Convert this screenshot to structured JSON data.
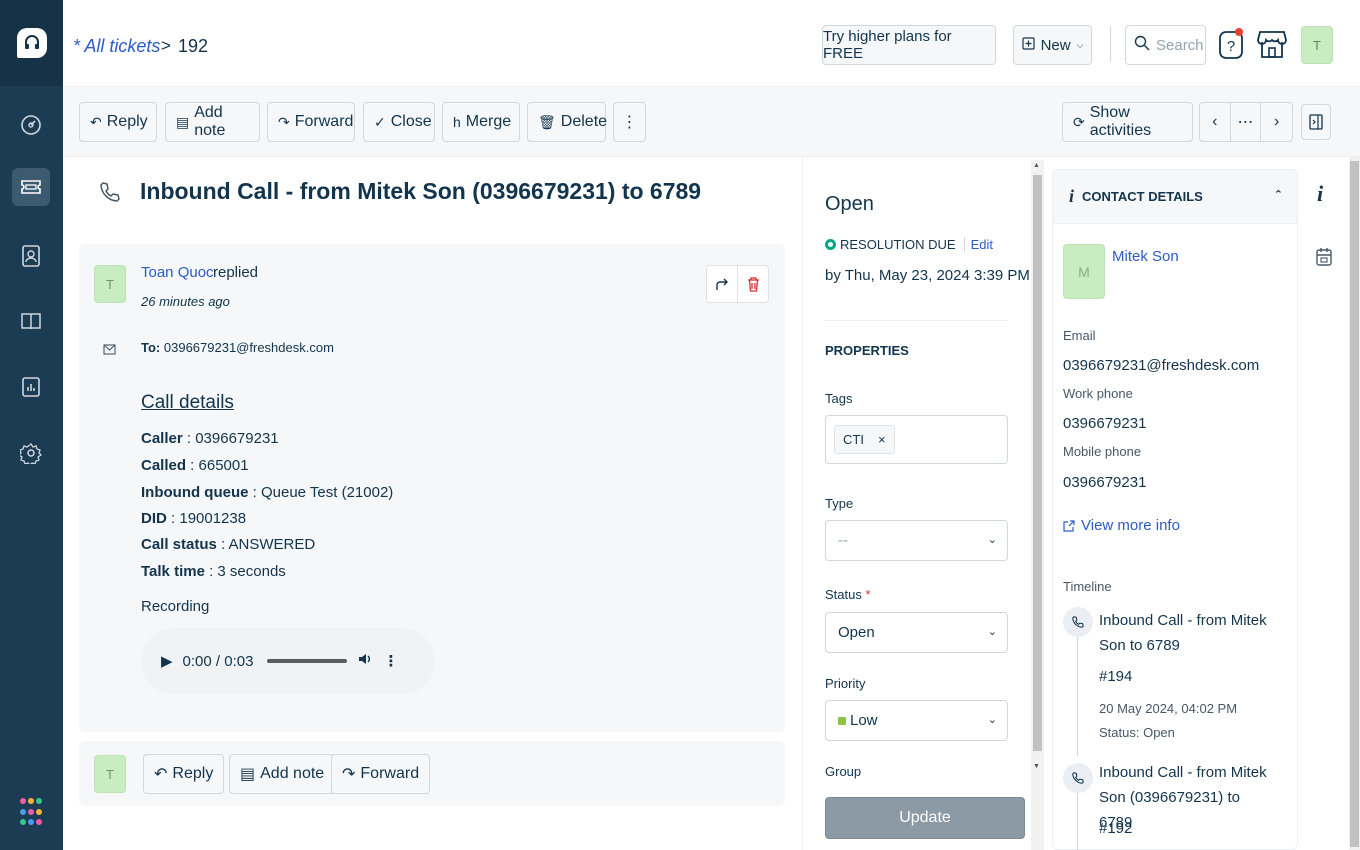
{
  "breadcrumb": {
    "all_tickets": "* All tickets",
    "separator": ">",
    "ticket_id": "192"
  },
  "topbar": {
    "try_plans": "Try higher plans for FREE",
    "new_label": "New",
    "search_placeholder": "Search",
    "avatar_initial": "T"
  },
  "actions": {
    "reply": "Reply",
    "add_note": "Add note",
    "forward": "Forward",
    "close": "Close",
    "merge": "Merge",
    "delete": "Delete",
    "show_activities": "Show activities",
    "more": "⋯"
  },
  "ticket": {
    "title": "Inbound Call - from Mitek Son (0396679231) to 6789",
    "author_initial": "T",
    "author": "Toan Quoc",
    "replied": "replied",
    "time_ago": "26 minutes ago",
    "to_label": "To:",
    "to_email": "0396679231@freshdesk.com",
    "call_details_heading": "Call details",
    "fields": [
      {
        "key": "Caller",
        "value": " : 0396679231"
      },
      {
        "key": "Called",
        "value": " : 665001"
      },
      {
        "key": "Inbound queue",
        "value": " : Queue Test (21002)"
      },
      {
        "key": "DID",
        "value": " : 19001238"
      },
      {
        "key": "Call status",
        "value": " : ANSWERED"
      },
      {
        "key": "Talk time",
        "value": " : 3 seconds"
      }
    ],
    "recording_label": "Recording",
    "audio_time": "0:00 / 0:03"
  },
  "reply_bar": {
    "avatar_initial": "T",
    "reply": "Reply",
    "add_note": "Add note",
    "forward": "Forward"
  },
  "properties": {
    "status_heading": "Open",
    "resolution_due": "RESOLUTION DUE",
    "edit": "Edit",
    "due_date": "by Thu, May 23, 2024 3:39 PM",
    "section_title": "PROPERTIES",
    "tags_label": "Tags",
    "tag_value": "CTI",
    "tag_remove": "×",
    "type_label": "Type",
    "type_value": "--",
    "status_label": "Status",
    "required_mark": "*",
    "status_value": "Open",
    "priority_label": "Priority",
    "priority_value": "Low",
    "priority_color": "#8bc34a",
    "group_label": "Group",
    "update": "Update"
  },
  "contact": {
    "header": "CONTACT DETAILS",
    "initial": "M",
    "name": "Mitek Son",
    "email_label": "Email",
    "email": "0396679231@freshdesk.com",
    "work_phone_label": "Work phone",
    "work_phone": "0396679231",
    "mobile_phone_label": "Mobile phone",
    "mobile_phone": "0396679231",
    "view_more": "View more info",
    "timeline_label": "Timeline",
    "timeline": [
      {
        "title": "Inbound Call - from Mitek Son to 6789",
        "id": "#194",
        "date": "20 May 2024, 04:02 PM",
        "status": "Status: Open"
      },
      {
        "title": "Inbound Call - from Mitek Son (0396679231) to 6789",
        "id": "#192"
      }
    ]
  },
  "colors": {
    "sidebar": "#1b3c53",
    "link": "#2c5cc5",
    "resolution_dot": "#00a886",
    "delete_red": "#d72d30"
  }
}
